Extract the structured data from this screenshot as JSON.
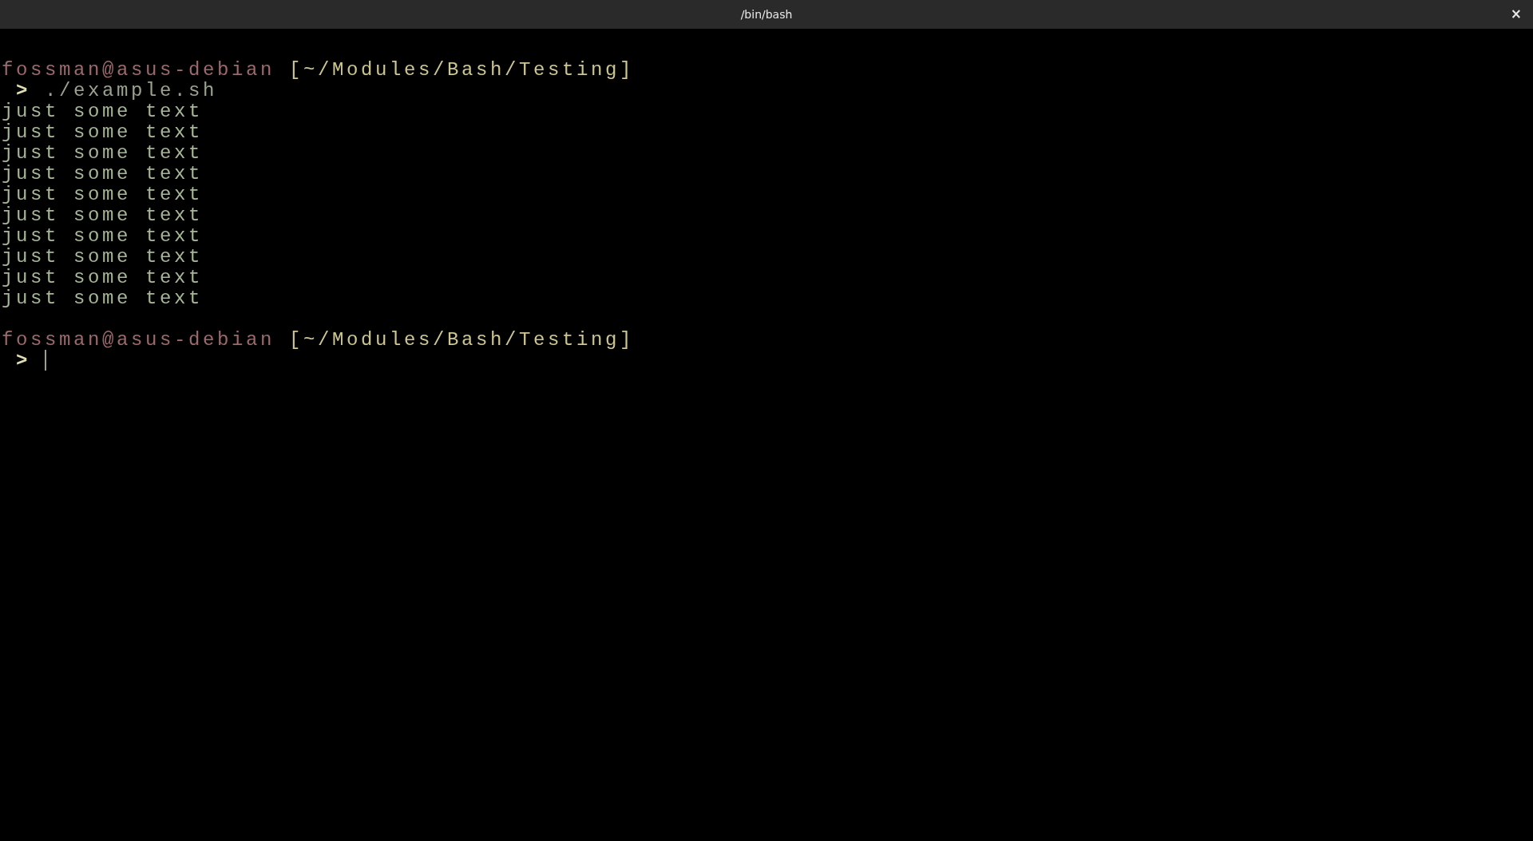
{
  "window": {
    "title": "/bin/bash",
    "close": "×"
  },
  "lines": [
    {
      "kind": "blank"
    },
    {
      "kind": "prompt",
      "user": "fossman",
      "at": "@",
      "host": "asus-debian",
      "path": "[~/Modules/Bash/Testing]"
    },
    {
      "kind": "command",
      "symbol": ">",
      "text": "./example.sh"
    },
    {
      "kind": "output",
      "text": "just some text"
    },
    {
      "kind": "output",
      "text": "just some text"
    },
    {
      "kind": "output",
      "text": "just some text"
    },
    {
      "kind": "output",
      "text": "just some text"
    },
    {
      "kind": "output",
      "text": "just some text"
    },
    {
      "kind": "output",
      "text": "just some text"
    },
    {
      "kind": "output",
      "text": "just some text"
    },
    {
      "kind": "output",
      "text": "just some text"
    },
    {
      "kind": "output",
      "text": "just some text"
    },
    {
      "kind": "output",
      "text": "just some text"
    },
    {
      "kind": "blank"
    },
    {
      "kind": "prompt",
      "user": "fossman",
      "at": "@",
      "host": "asus-debian",
      "path": "[~/Modules/Bash/Testing]"
    },
    {
      "kind": "input",
      "symbol": ">",
      "cursor": true
    }
  ]
}
